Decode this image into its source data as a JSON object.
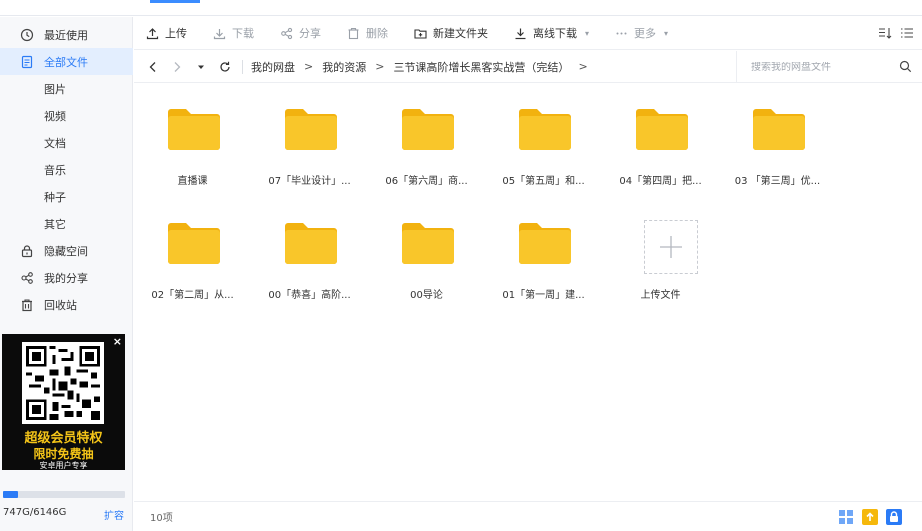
{
  "sidebar": {
    "items": [
      {
        "label": "最近使用",
        "icon": "clock-icon"
      },
      {
        "label": "全部文件",
        "icon": "file-icon",
        "active": true
      },
      {
        "label": "图片"
      },
      {
        "label": "视频"
      },
      {
        "label": "文档"
      },
      {
        "label": "音乐"
      },
      {
        "label": "种子"
      },
      {
        "label": "其它"
      },
      {
        "label": "隐藏空间",
        "icon": "lock-icon"
      },
      {
        "label": "我的分享",
        "icon": "share-icon"
      },
      {
        "label": "回收站",
        "icon": "trash-icon"
      }
    ],
    "ad": {
      "line1": "超级会员特权",
      "line2": "限时免费抽",
      "line3": "安卓用户专享",
      "close": "×"
    },
    "storage": {
      "used_text": "747G/6146G",
      "used_fraction": 0.1215,
      "expand_label": "扩容"
    }
  },
  "toolbar": {
    "upload": "上传",
    "download": "下载",
    "share": "分享",
    "delete": "删除",
    "new_folder": "新建文件夹",
    "offline_download": "离线下载",
    "more": "更多"
  },
  "address": {
    "crumbs": [
      "我的网盘",
      "我的资源",
      "三节课高阶增长黑客实战营（完结）"
    ],
    "search_placeholder": "搜索我的网盘文件"
  },
  "files": [
    "直播课",
    "07「毕业设计」...",
    "06「第六周」商...",
    "05「第五周」和...",
    "04「第四周」把...",
    "03 「第三周」优...",
    "02「第二周」从...",
    "00「恭喜」高阶...",
    "00导论",
    "01「第一周」建..."
  ],
  "upload_tile_label": "上传文件",
  "status": {
    "count_text": "10项"
  },
  "colors": {
    "accent": "#2b7bf6",
    "folder": "#f9c62a",
    "ad_text": "#f5c518"
  }
}
